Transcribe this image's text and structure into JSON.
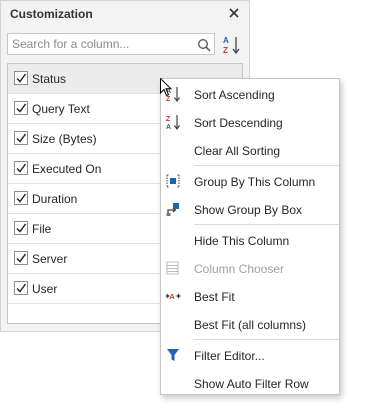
{
  "panel": {
    "title": "Customization",
    "search_placeholder": "Search for a column...",
    "columns": [
      {
        "label": "Status",
        "checked": true
      },
      {
        "label": "Query Text",
        "checked": true
      },
      {
        "label": "Size (Bytes)",
        "checked": true
      },
      {
        "label": "Executed On",
        "checked": true
      },
      {
        "label": "Duration",
        "checked": true
      },
      {
        "label": "File",
        "checked": true
      },
      {
        "label": "Server",
        "checked": true
      },
      {
        "label": "User",
        "checked": true
      }
    ]
  },
  "context_menu": {
    "items": [
      {
        "label": "Sort Ascending",
        "icon": "sort-ascending-icon"
      },
      {
        "label": "Sort Descending",
        "icon": "sort-descending-icon"
      },
      {
        "label": "Clear All Sorting",
        "icon": ""
      },
      {
        "label": "Group By This Column",
        "icon": "group-by-column-icon"
      },
      {
        "label": "Show Group By Box",
        "icon": "group-by-box-icon"
      },
      {
        "label": "Hide This Column",
        "icon": ""
      },
      {
        "label": "Column Chooser",
        "icon": "column-chooser-icon",
        "disabled": true
      },
      {
        "label": "Best Fit",
        "icon": "best-fit-icon"
      },
      {
        "label": "Best Fit (all columns)",
        "icon": ""
      },
      {
        "label": "Filter Editor...",
        "icon": "filter-icon"
      },
      {
        "label": "Show Auto Filter Row",
        "icon": ""
      }
    ]
  },
  "colors": {
    "accent_blue": "#1f64b4",
    "accent_red": "#d1342b"
  }
}
